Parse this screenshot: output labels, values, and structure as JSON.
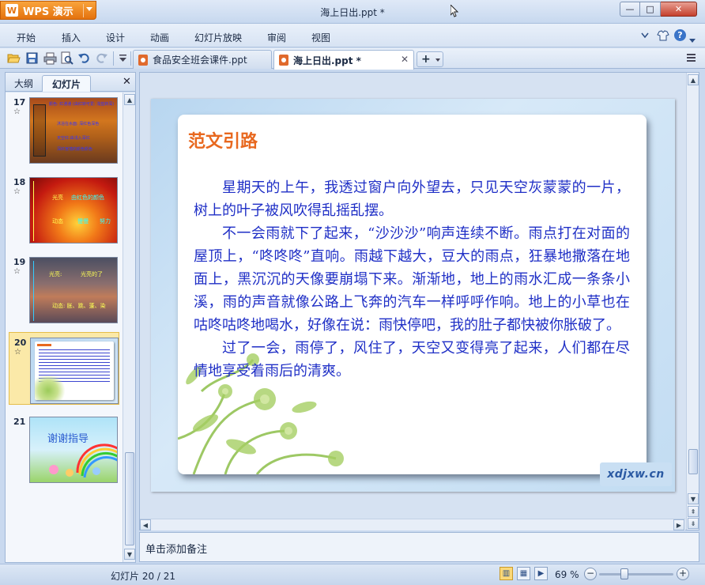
{
  "app": {
    "name": "WPS 演示",
    "window_title": "海上日出.ppt *"
  },
  "window_controls": {
    "minimize": "—",
    "maximize": "□",
    "close": "✕"
  },
  "menu": [
    "开始",
    "插入",
    "设计",
    "动画",
    "幻灯片放映",
    "审阅",
    "视图"
  ],
  "toolbar_icons": [
    "open-folder-icon",
    "save-icon",
    "print-icon",
    "print-preview-icon",
    "undo-icon",
    "redo-icon",
    "customize-dropdown-icon"
  ],
  "doc_tabs": [
    {
      "label": "食品安全班会课件.ppt",
      "active": false
    },
    {
      "label": "海上日出.ppt *",
      "active": true
    }
  ],
  "new_tab_label": "+",
  "left_panel": {
    "tabs": [
      "大纲",
      "幻灯片"
    ],
    "active_tab": "幻灯片",
    "slides": [
      {
        "number": "17",
        "selected": false
      },
      {
        "number": "18",
        "selected": false
      },
      {
        "number": "19",
        "selected": false
      },
      {
        "number": "20",
        "selected": true
      },
      {
        "number": "21",
        "selected": false
      }
    ],
    "star": "☆",
    "thumb_text": {
      "s17": [
        "颜色: 红通通 (由红转可爱: 浅蓝转深)",
        "沐浴在水面: 深红色深色",
        "天空红:由浅入深红",
        "深红宫墙的颜色颜色"
      ],
      "s18": [
        "光亮",
        "由红色的颜色",
        "动态",
        "慢慢",
        "努力"
      ],
      "s19": [
        "光亮:",
        "光亮的了",
        "动态: 胀、跳、蓬、染"
      ],
      "s21": [
        "谢谢指导"
      ]
    }
  },
  "slide": {
    "title": "范文引路",
    "paragraphs": [
      "星期天的上午，我透过窗户向外望去，只见天空灰蒙蒙的一片，树上的叶子被风吹得乱摇乱摆。",
      "不一会雨就下了起来，“沙沙沙”响声连续不断。雨点打在对面的屋顶上，“咚咚咚”直响。雨越下越大，豆大的雨点，狂暴地撒落在地面上，黑沉沉的天像要崩塌下来。渐渐地，地上的雨水汇成一条条小溪，雨的声音就像公路上飞奔的汽车一样呼呼作响。地上的小草也在咕咚咕咚地喝水，好像在说：雨快停吧，我的肚子都快被你胀破了。",
      "过了一会，雨停了，风住了，天空又变得亮了起来，人们都在尽情地享受着雨后的清爽。"
    ],
    "watermark": "xdjxw.cn"
  },
  "notes_placeholder": "单击添加备注",
  "status": {
    "slide_info": "幻灯片 20 / 21",
    "zoom": "69 %",
    "zoom_level": 0.69
  },
  "colors": {
    "accent_orange": "#e8681f",
    "body_blue": "#1f2fc6",
    "wps_orange": "#f29022"
  }
}
